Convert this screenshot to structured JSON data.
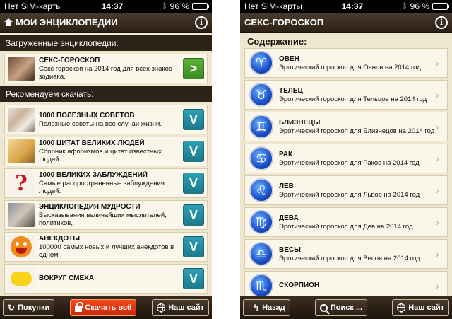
{
  "status": {
    "carrier": "Нет SIM-карты",
    "time": "14:37",
    "battery": "96 %",
    "battery_fraction": 0.96
  },
  "left": {
    "title": "МОИ ЭНЦИКЛОПЕДИИ",
    "info_label": "i",
    "downloaded_header": "Загруженные энциклопедии:",
    "downloaded": [
      {
        "title": "СЕКС-ГОРОСКОП",
        "subtitle": "Секс гороскоп на 2014 год для всех знаков зодиака.",
        "thumb": "couple",
        "action": ">"
      }
    ],
    "recommended_header": "Рекомендуем скачать:",
    "recommended": [
      {
        "title": "1000 ПОЛЕЗНЫХ СОВЕТОВ",
        "subtitle": "Полезные советы на все случаи жизни.",
        "thumb": "people",
        "action": "V"
      },
      {
        "title": "1000 ЦИТАТ ВЕЛИКИХ ЛЮДЕЙ",
        "subtitle": "Сборник афоризмов и цитат известных людей.",
        "thumb": "feather",
        "action": "V"
      },
      {
        "title": "1000 ВЕЛИКИХ ЗАБЛУЖДЕНИЙ",
        "subtitle": "Самые распространенные заблуждения людей.",
        "thumb": "question",
        "action": "V"
      },
      {
        "title": "ЭНЦИКЛОПЕДИЯ МУДРОСТИ",
        "subtitle": "Высказывания величайших мыслителей, политиков,",
        "thumb": "sage",
        "action": "V"
      },
      {
        "title": "АНЕКДОТЫ",
        "subtitle": "100000 самых новых и лучших анекдотов в одном",
        "thumb": "smiley",
        "action": "V"
      },
      {
        "title": "ВОКРУГ СМЕХА",
        "subtitle": "",
        "thumb": "yellow",
        "action": "V"
      }
    ],
    "toolbar": {
      "purchases": "Покупки",
      "download_all": "Скачать всё",
      "site": "Наш сайт"
    }
  },
  "right": {
    "title": "СЕКС-ГОРОСКОП",
    "info_label": "i",
    "contents_header": "Содержание:",
    "signs": [
      {
        "title": "ОВЕН",
        "subtitle": "Эротический гороскоп для Овнов на 2014 год",
        "glyph": "♈",
        "icon": "aries-icon"
      },
      {
        "title": "ТЕЛЕЦ",
        "subtitle": "Эротический гороскоп для Тельцов на 2014 год",
        "glyph": "♉",
        "icon": "taurus-icon"
      },
      {
        "title": "БЛИЗНЕЦЫ",
        "subtitle": "Эротический гороскоп для Близнецов на 2014 год",
        "glyph": "♊",
        "icon": "gemini-icon"
      },
      {
        "title": "РАК",
        "subtitle": "Эротический гороскоп для Раков на 2014 год",
        "glyph": "♋",
        "icon": "cancer-icon"
      },
      {
        "title": "ЛЕВ",
        "subtitle": "Эротический гороскоп для Львов на 2014 год",
        "glyph": "♌",
        "icon": "leo-icon"
      },
      {
        "title": "ДЕВА",
        "subtitle": "Эротический гороскоп для Дев на 2014 год",
        "glyph": "♍",
        "icon": "virgo-icon"
      },
      {
        "title": "ВЕСЫ",
        "subtitle": "Эротический гороскоп для Весов на 2014 год",
        "glyph": "♎",
        "icon": "libra-icon"
      },
      {
        "title": "СКОРПИОН",
        "subtitle": "",
        "glyph": "♏",
        "icon": "scorpio-icon"
      }
    ],
    "chevron": "›",
    "toolbar": {
      "back": "Назад",
      "search": "Поиск ...",
      "site": "Наш сайт"
    }
  },
  "colors": {
    "background": "#efe6cf",
    "navbar": "#2c2117",
    "open_button": "#3a8a22",
    "download_button": "#1a7a8c",
    "download_all_button": "#c8280a",
    "zodiac_badge": "#1a4fc8"
  }
}
